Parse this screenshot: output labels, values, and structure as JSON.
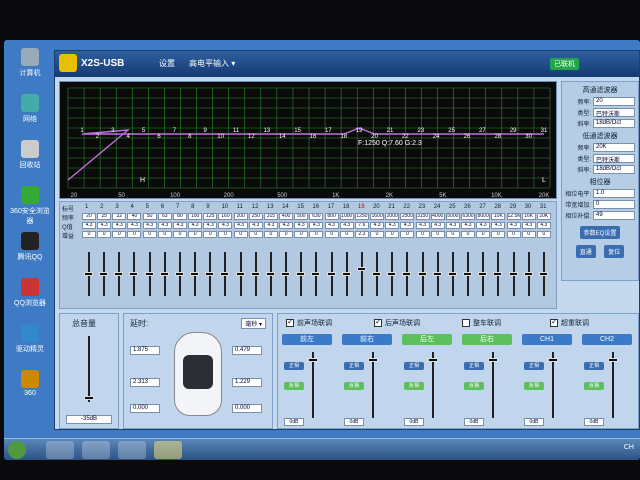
{
  "desktop": {
    "icons": [
      {
        "label": "计算机"
      },
      {
        "label": "网络"
      },
      {
        "label": "回收站"
      },
      {
        "label": "360安全浏览器"
      },
      {
        "label": "腾讯QQ"
      },
      {
        "label": "QQ浏览器"
      },
      {
        "label": "驱动精灵"
      },
      {
        "label": "360"
      }
    ]
  },
  "app": {
    "title": "X2S-USB",
    "menu": [
      "设置",
      "高电平输入 ▾"
    ],
    "connection_status": "已联机"
  },
  "graph": {
    "annotation": "F:1250 Q:7.60 G:2.3",
    "freq_ticks": [
      "20",
      "50",
      "100",
      "200",
      "500",
      "1K",
      "2K",
      "5K",
      "10K",
      "20K"
    ],
    "point_labels": [
      "1",
      "2",
      "3",
      "4",
      "5",
      "6",
      "7",
      "8",
      "9",
      "10",
      "11",
      "12",
      "13",
      "14",
      "15",
      "16",
      "17",
      "18",
      "19",
      "20",
      "21",
      "22",
      "23",
      "24",
      "25",
      "26",
      "27",
      "28",
      "29",
      "30",
      "31"
    ],
    "marker_h": "H",
    "marker_l": "L"
  },
  "right_panel": {
    "hp_title": "高通滤波器",
    "lp_title": "低通滤波器",
    "rows": [
      {
        "label": "频率:",
        "value": "20"
      },
      {
        "label": "类型:",
        "value": "巴特沃斯"
      },
      {
        "label": "斜率:",
        "value": "18dB/Oct"
      }
    ],
    "rows_lp": [
      {
        "label": "频率:",
        "value": "20K"
      },
      {
        "label": "类型:",
        "value": "巴特沃斯"
      },
      {
        "label": "斜率:",
        "value": "18dB/Oct"
      }
    ],
    "phase_title": "相位器",
    "phase_rows": [
      {
        "label": "相位电平:",
        "value": "1.0"
      },
      {
        "label": "带宽增加:",
        "value": "0"
      },
      {
        "label": "相位补偿:",
        "value": "49"
      }
    ],
    "buttons": [
      "参数EQ设置",
      "直通",
      "复位"
    ]
  },
  "eq": {
    "row_labels": [
      "标号",
      "频率",
      "Q值",
      "增益"
    ],
    "bands": [
      {
        "n": "1",
        "f": "20",
        "q": "4.3",
        "g": "0"
      },
      {
        "n": "2",
        "f": "25",
        "q": "4.3",
        "g": "0"
      },
      {
        "n": "3",
        "f": "32",
        "q": "4.3",
        "g": "0"
      },
      {
        "n": "4",
        "f": "40",
        "q": "4.3",
        "g": "0"
      },
      {
        "n": "5",
        "f": "50",
        "q": "4.3",
        "g": "0"
      },
      {
        "n": "6",
        "f": "63",
        "q": "4.3",
        "g": "0"
      },
      {
        "n": "7",
        "f": "80",
        "q": "4.3",
        "g": "0"
      },
      {
        "n": "8",
        "f": "100",
        "q": "4.3",
        "g": "0"
      },
      {
        "n": "9",
        "f": "125",
        "q": "4.3",
        "g": "0"
      },
      {
        "n": "10",
        "f": "160",
        "q": "4.3",
        "g": "0"
      },
      {
        "n": "11",
        "f": "200",
        "q": "4.3",
        "g": "0"
      },
      {
        "n": "12",
        "f": "250",
        "q": "4.3",
        "g": "0"
      },
      {
        "n": "13",
        "f": "315",
        "q": "4.3",
        "g": "0"
      },
      {
        "n": "14",
        "f": "400",
        "q": "4.3",
        "g": "0"
      },
      {
        "n": "15",
        "f": "500",
        "q": "4.3",
        "g": "0"
      },
      {
        "n": "16",
        "f": "630",
        "q": "4.3",
        "g": "0"
      },
      {
        "n": "17",
        "f": "800",
        "q": "4.3",
        "g": "0"
      },
      {
        "n": "18",
        "f": "1000",
        "q": "4.3",
        "g": "0"
      },
      {
        "n": "19",
        "f": "1250",
        "q": "7.6",
        "g": "2.3"
      },
      {
        "n": "20",
        "f": "1600",
        "q": "4.3",
        "g": "0"
      },
      {
        "n": "21",
        "f": "2000",
        "q": "4.3",
        "g": "0"
      },
      {
        "n": "22",
        "f": "2500",
        "q": "4.3",
        "g": "0"
      },
      {
        "n": "23",
        "f": "3150",
        "q": "4.3",
        "g": "0"
      },
      {
        "n": "24",
        "f": "4000",
        "q": "4.3",
        "g": "0"
      },
      {
        "n": "25",
        "f": "5000",
        "q": "4.3",
        "g": "0"
      },
      {
        "n": "26",
        "f": "6300",
        "q": "4.3",
        "g": "0"
      },
      {
        "n": "27",
        "f": "8000",
        "q": "4.3",
        "g": "0"
      },
      {
        "n": "28",
        "f": "10K",
        "q": "4.3",
        "g": "0"
      },
      {
        "n": "29",
        "f": "12.5K",
        "q": "4.3",
        "g": "0"
      },
      {
        "n": "30",
        "f": "16K",
        "q": "4.3",
        "g": "0"
      },
      {
        "n": "31",
        "f": "20K",
        "q": "4.3",
        "g": "0"
      }
    ]
  },
  "volume": {
    "title": "总音量",
    "value": "-35dB"
  },
  "delay": {
    "title": "延时:",
    "unit_select": "毫秒 ▾",
    "fields": [
      "1.875",
      "0.479",
      "2.313",
      "1.229",
      "0.000",
      "0.000"
    ]
  },
  "channels": {
    "links": [
      {
        "label": "前声场联调",
        "checked": true
      },
      {
        "label": "后声场联调",
        "checked": true
      },
      {
        "label": "整车联调",
        "checked": false
      },
      {
        "label": "超重联调",
        "checked": true
      }
    ],
    "cols": [
      {
        "name": "前左",
        "color": "#3a7ac8",
        "db": "0dB"
      },
      {
        "name": "前右",
        "color": "#3a7ac8",
        "db": "0dB"
      },
      {
        "name": "后左",
        "color": "#5cc05c",
        "db": "0dB"
      },
      {
        "name": "后右",
        "color": "#5cc05c",
        "db": "0dB"
      },
      {
        "name": "CH1",
        "color": "#3a7ac8",
        "db": "0dB"
      },
      {
        "name": "CH2",
        "color": "#3a7ac8",
        "db": "0dB"
      }
    ],
    "btn_labels": [
      "正相",
      "反相"
    ]
  },
  "taskbar": {
    "tray": "CH"
  }
}
